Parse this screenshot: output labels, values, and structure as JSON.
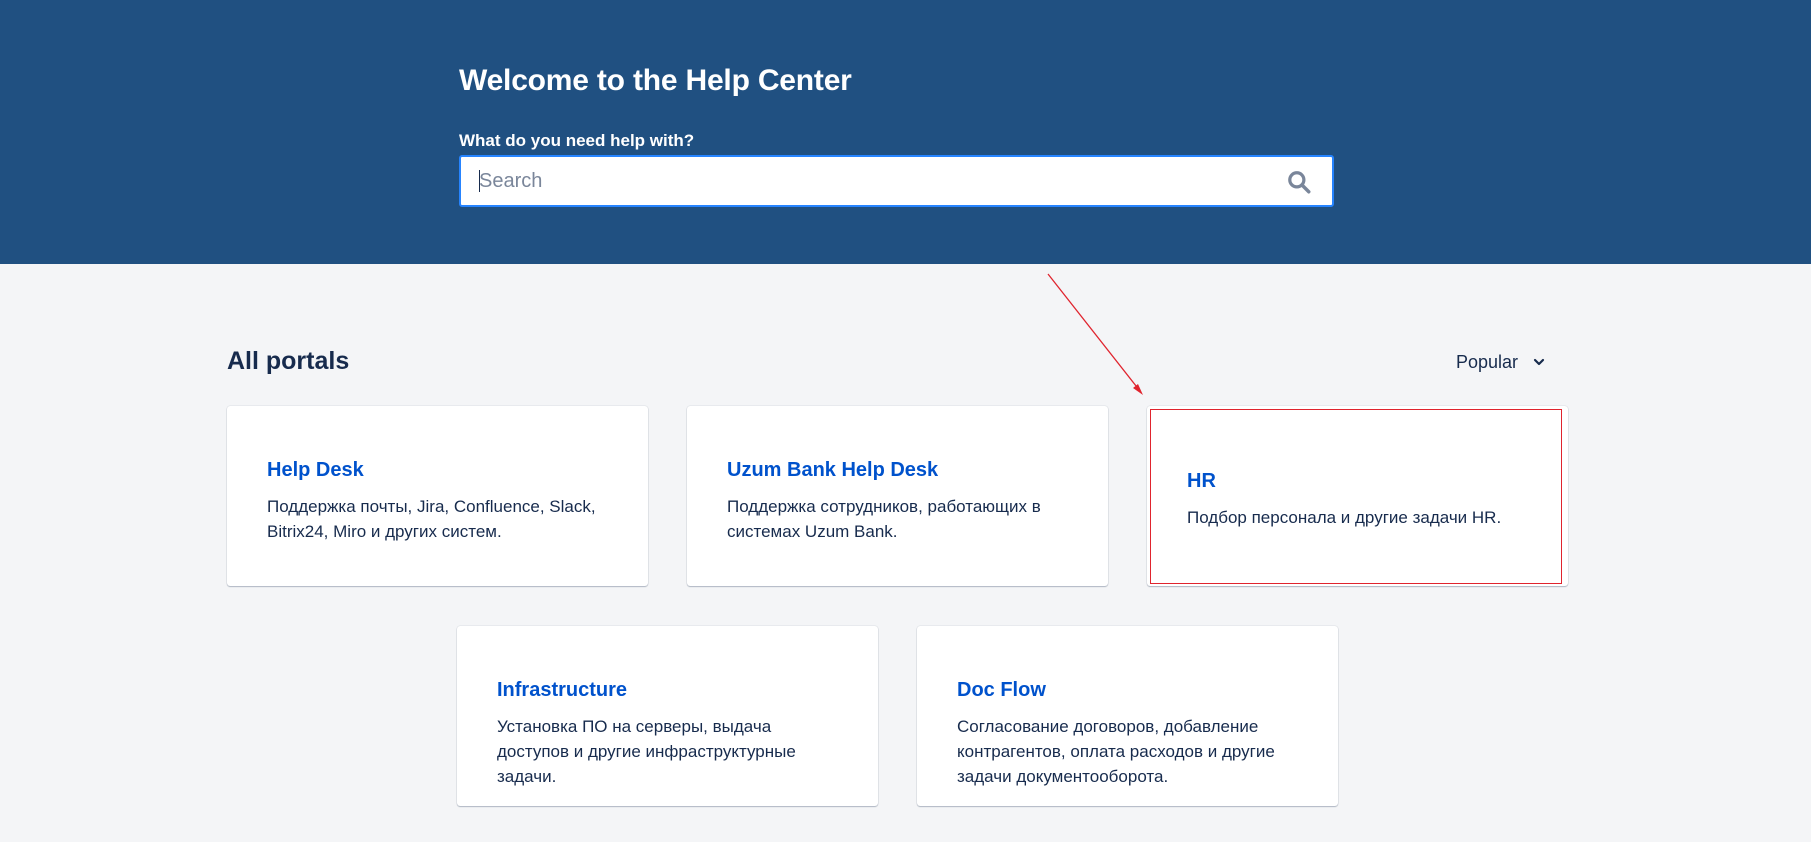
{
  "hero": {
    "title": "Welcome to the Help Center",
    "search_label": "What do you need help with?",
    "search_placeholder": "Search",
    "search_icon": "search-icon"
  },
  "portals": {
    "title": "All portals",
    "sort_label": "Popular",
    "sort_icon": "chevron-down-icon",
    "cards": [
      {
        "title": "Help Desk",
        "description": "Поддержка почты, Jira, Confluence, Slack, Bitrix24, Miro и других систем."
      },
      {
        "title": "Uzum Bank Help Desk",
        "description": "Поддержка сотрудников, работающих в системах Uzum Bank."
      },
      {
        "title": "HR",
        "description": "Подбор персонала и другие задачи HR."
      },
      {
        "title": "Infrastructure",
        "description": "Установка ПО на серверы, выдача доступов и другие инфраструктурные задачи."
      },
      {
        "title": "Doc Flow",
        "description": "Согласование договоров, добавление контрагентов, оплата расходов и другие задачи документооборота."
      }
    ]
  },
  "colors": {
    "hero_bg": "#205081",
    "page_bg": "#f4f5f7",
    "link": "#0052cc",
    "annotation": "#e0242e"
  }
}
